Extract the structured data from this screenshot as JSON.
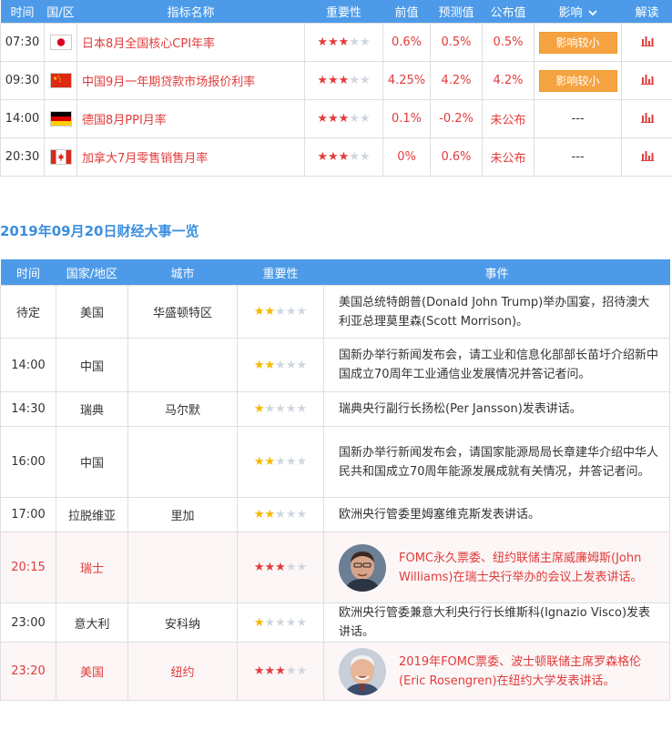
{
  "calendar": {
    "headers": [
      "时间",
      "国/区",
      "指标名称",
      "重要性",
      "前值",
      "预测值",
      "公布值",
      "影响",
      "解读"
    ],
    "rows": [
      {
        "time": "07:30",
        "flag": "japan",
        "name": "日本8月全国核心CPI年率",
        "stars": 3,
        "prev": "0.6%",
        "forecast": "0.5%",
        "actual": "0.5%",
        "impact": "影响较小"
      },
      {
        "time": "09:30",
        "flag": "china",
        "name": "中国9月一年期贷款市场报价利率",
        "stars": 3,
        "prev": "4.25%",
        "forecast": "4.2%",
        "actual": "4.2%",
        "impact": "影响较小"
      },
      {
        "time": "14:00",
        "flag": "germany",
        "name": "德国8月PPI月率",
        "stars": 3,
        "prev": "0.1%",
        "forecast": "-0.2%",
        "actual": "未公布",
        "impact": "---"
      },
      {
        "time": "20:30",
        "flag": "canada",
        "name": "加拿大7月零售销售月率",
        "stars": 3,
        "prev": "0%",
        "forecast": "0.6%",
        "actual": "未公布",
        "impact": "---"
      }
    ]
  },
  "events_title": "2019年09月20日财经大事一览",
  "events": {
    "headers": [
      "时间",
      "国家/地区",
      "城市",
      "重要性",
      "事件"
    ],
    "rows": [
      {
        "time": "待定",
        "country": "美国",
        "city": "华盛顿特区",
        "stars": 2,
        "event": "美国总统特朗普(Donald John Trump)举办国宴，招待澳大利亚总理莫里森(Scott Morrison)。",
        "highlight": false
      },
      {
        "time": "14:00",
        "country": "中国",
        "city": "",
        "stars": 2,
        "event": "国新办举行新闻发布会，请工业和信息化部部长苗圩介绍新中国成立70周年工业通信业发展情况并答记者问。",
        "highlight": false
      },
      {
        "time": "14:30",
        "country": "瑞典",
        "city": "马尔默",
        "stars": 1,
        "event": "瑞典央行副行长扬松(Per Jansson)发表讲话。",
        "highlight": false
      },
      {
        "time": "16:00",
        "country": "中国",
        "city": "",
        "stars": 2,
        "event": "国新办举行新闻发布会，请国家能源局局长章建华介绍中华人民共和国成立70周年能源发展成就有关情况，并答记者问。",
        "highlight": false
      },
      {
        "time": "17:00",
        "country": "拉脱维亚",
        "city": "里加",
        "stars": 2,
        "event": "欧洲央行管委里姆塞维克斯发表讲话。",
        "highlight": false
      },
      {
        "time": "20:15",
        "country": "瑞士",
        "city": "",
        "stars": 3,
        "event": "FOMC永久票委、纽约联储主席威廉姆斯(John Williams)在瑞士央行举办的会议上发表讲话。",
        "highlight": true,
        "avatar": "man-dark-hair"
      },
      {
        "time": "23:00",
        "country": "意大利",
        "city": "安科纳",
        "stars": 1,
        "event": "欧洲央行管委兼意大利央行行长维斯科(Ignazio Visco)发表讲话。",
        "highlight": false
      },
      {
        "time": "23:20",
        "country": "美国",
        "city": "纽约",
        "stars": 3,
        "event": "2019年FOMC票委、波士顿联储主席罗森格伦(Eric Rosengren)在纽约大学发表讲话。",
        "highlight": true,
        "avatar": "man-white-hair"
      }
    ]
  },
  "icons": {
    "impact_dropdown": "chevron-down-icon",
    "analysis": "bar-chart-icon"
  },
  "colors": {
    "header_bg": "#4d9be8",
    "accent_red": "#e23b3b",
    "badge_orange": "#f5a340",
    "star_gold": "#f5b800",
    "title_blue": "#3c8ee0"
  }
}
